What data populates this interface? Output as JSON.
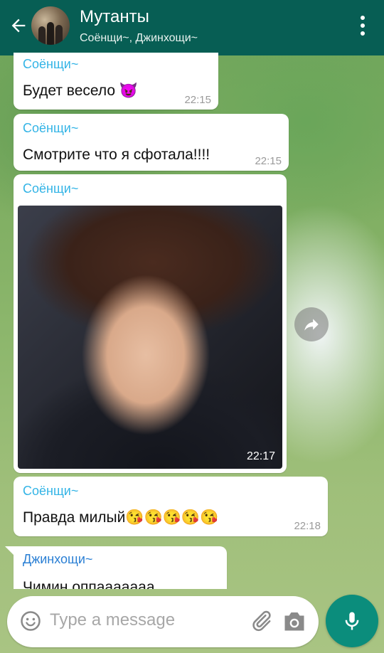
{
  "header": {
    "title": "Мутанты",
    "subtitle": "Соёнщи~, Джинхощи~"
  },
  "messages": [
    {
      "sender": "Соёнщи~",
      "text": "Будет весело 😈",
      "time": "22:15"
    },
    {
      "sender": "Соёнщи~",
      "text": "Смотрите что я сфотала!!!!",
      "time": "22:15"
    },
    {
      "sender": "Соёнщи~",
      "type": "image",
      "time": "22:17"
    },
    {
      "sender": "Соёнщи~",
      "text": "Правда милый😘😘😘😘😘",
      "time": "22:18"
    },
    {
      "sender": "Джинхощи~",
      "text": "Чимин оппааааааа"
    }
  ],
  "composer": {
    "placeholder": "Type a message"
  },
  "colors": {
    "app_bar": "#075e54",
    "sender_soyeon": "#33b4e6",
    "sender_jinho": "#2a7fd4",
    "mic_button": "#0b8d7c"
  },
  "icons": [
    "back-arrow-icon",
    "more-vert-icon",
    "forward-icon",
    "emoji-icon",
    "paperclip-icon",
    "camera-icon",
    "mic-icon"
  ]
}
